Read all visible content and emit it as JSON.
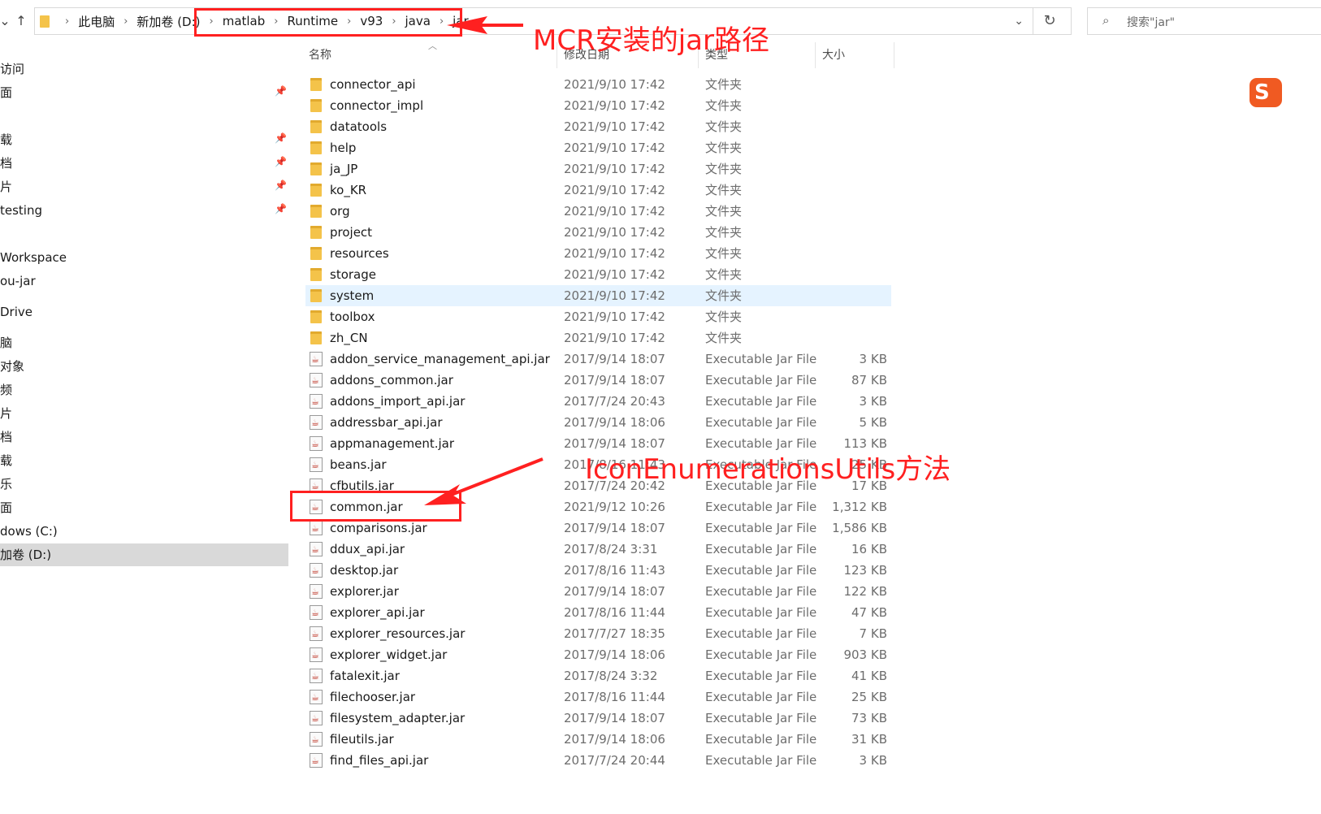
{
  "address_bar": {
    "crumbs": [
      "此电脑",
      "新加卷 (D:)",
      "matlab",
      "Runtime",
      "v93",
      "java",
      "jar"
    ],
    "search_placeholder": "搜索\"jar\""
  },
  "sidebar": {
    "items": [
      {
        "label": "访问"
      },
      {
        "label": "面"
      },
      {
        "label": "载"
      },
      {
        "label": "档"
      },
      {
        "label": "片"
      },
      {
        "label": "testing"
      },
      {
        "label": "Workspace"
      },
      {
        "label": "ou-jar"
      },
      {
        "label": "Drive"
      },
      {
        "label": "脑"
      },
      {
        "label": "对象"
      },
      {
        "label": "频"
      },
      {
        "label": "片"
      },
      {
        "label": "档"
      },
      {
        "label": "载"
      },
      {
        "label": "乐"
      },
      {
        "label": "面"
      },
      {
        "label": "dows (C:)"
      },
      {
        "label": "加卷 (D:)"
      }
    ]
  },
  "columns": {
    "name": "名称",
    "date": "修改日期",
    "type": "类型",
    "size": "大小"
  },
  "files": [
    {
      "name": "connector_api",
      "date": "2021/9/10 17:42",
      "type": "文件夹",
      "size": "",
      "kind": "folder"
    },
    {
      "name": "connector_impl",
      "date": "2021/9/10 17:42",
      "type": "文件夹",
      "size": "",
      "kind": "folder"
    },
    {
      "name": "datatools",
      "date": "2021/9/10 17:42",
      "type": "文件夹",
      "size": "",
      "kind": "folder"
    },
    {
      "name": "help",
      "date": "2021/9/10 17:42",
      "type": "文件夹",
      "size": "",
      "kind": "folder"
    },
    {
      "name": "ja_JP",
      "date": "2021/9/10 17:42",
      "type": "文件夹",
      "size": "",
      "kind": "folder"
    },
    {
      "name": "ko_KR",
      "date": "2021/9/10 17:42",
      "type": "文件夹",
      "size": "",
      "kind": "folder"
    },
    {
      "name": "org",
      "date": "2021/9/10 17:42",
      "type": "文件夹",
      "size": "",
      "kind": "folder"
    },
    {
      "name": "project",
      "date": "2021/9/10 17:42",
      "type": "文件夹",
      "size": "",
      "kind": "folder"
    },
    {
      "name": "resources",
      "date": "2021/9/10 17:42",
      "type": "文件夹",
      "size": "",
      "kind": "folder"
    },
    {
      "name": "storage",
      "date": "2021/9/10 17:42",
      "type": "文件夹",
      "size": "",
      "kind": "folder"
    },
    {
      "name": "system",
      "date": "2021/9/10 17:42",
      "type": "文件夹",
      "size": "",
      "kind": "folder",
      "selected": true
    },
    {
      "name": "toolbox",
      "date": "2021/9/10 17:42",
      "type": "文件夹",
      "size": "",
      "kind": "folder"
    },
    {
      "name": "zh_CN",
      "date": "2021/9/10 17:42",
      "type": "文件夹",
      "size": "",
      "kind": "folder"
    },
    {
      "name": "addon_service_management_api.jar",
      "date": "2017/9/14 18:07",
      "type": "Executable Jar File",
      "size": "3 KB",
      "kind": "jar"
    },
    {
      "name": "addons_common.jar",
      "date": "2017/9/14 18:07",
      "type": "Executable Jar File",
      "size": "87 KB",
      "kind": "jar"
    },
    {
      "name": "addons_import_api.jar",
      "date": "2017/7/24 20:43",
      "type": "Executable Jar File",
      "size": "3 KB",
      "kind": "jar"
    },
    {
      "name": "addressbar_api.jar",
      "date": "2017/9/14 18:06",
      "type": "Executable Jar File",
      "size": "5 KB",
      "kind": "jar"
    },
    {
      "name": "appmanagement.jar",
      "date": "2017/9/14 18:07",
      "type": "Executable Jar File",
      "size": "113 KB",
      "kind": "jar"
    },
    {
      "name": "beans.jar",
      "date": "2017/8/16 11:43",
      "type": "Executable Jar File",
      "size": "25 KB",
      "kind": "jar"
    },
    {
      "name": "cfbutils.jar",
      "date": "2017/7/24 20:42",
      "type": "Executable Jar File",
      "size": "17 KB",
      "kind": "jar"
    },
    {
      "name": "common.jar",
      "date": "2021/9/12 10:26",
      "type": "Executable Jar File",
      "size": "1,312 KB",
      "kind": "jar"
    },
    {
      "name": "comparisons.jar",
      "date": "2017/9/14 18:07",
      "type": "Executable Jar File",
      "size": "1,586 KB",
      "kind": "jar"
    },
    {
      "name": "ddux_api.jar",
      "date": "2017/8/24 3:31",
      "type": "Executable Jar File",
      "size": "16 KB",
      "kind": "jar"
    },
    {
      "name": "desktop.jar",
      "date": "2017/8/16 11:43",
      "type": "Executable Jar File",
      "size": "123 KB",
      "kind": "jar"
    },
    {
      "name": "explorer.jar",
      "date": "2017/9/14 18:07",
      "type": "Executable Jar File",
      "size": "122 KB",
      "kind": "jar"
    },
    {
      "name": "explorer_api.jar",
      "date": "2017/8/16 11:44",
      "type": "Executable Jar File",
      "size": "47 KB",
      "kind": "jar"
    },
    {
      "name": "explorer_resources.jar",
      "date": "2017/7/27 18:35",
      "type": "Executable Jar File",
      "size": "7 KB",
      "kind": "jar"
    },
    {
      "name": "explorer_widget.jar",
      "date": "2017/9/14 18:06",
      "type": "Executable Jar File",
      "size": "903 KB",
      "kind": "jar"
    },
    {
      "name": "fatalexit.jar",
      "date": "2017/8/24 3:32",
      "type": "Executable Jar File",
      "size": "41 KB",
      "kind": "jar"
    },
    {
      "name": "filechooser.jar",
      "date": "2017/8/16 11:44",
      "type": "Executable Jar File",
      "size": "25 KB",
      "kind": "jar"
    },
    {
      "name": "filesystem_adapter.jar",
      "date": "2017/9/14 18:07",
      "type": "Executable Jar File",
      "size": "73 KB",
      "kind": "jar"
    },
    {
      "name": "fileutils.jar",
      "date": "2017/9/14 18:06",
      "type": "Executable Jar File",
      "size": "31 KB",
      "kind": "jar"
    },
    {
      "name": "find_files_api.jar",
      "date": "2017/7/24 20:44",
      "type": "Executable Jar File",
      "size": "3 KB",
      "kind": "jar"
    }
  ],
  "annotations": {
    "path_note": "MCR安装的jar路径",
    "method_note": "IconEnumerationsUtils方法",
    "color": "#ff2020"
  }
}
